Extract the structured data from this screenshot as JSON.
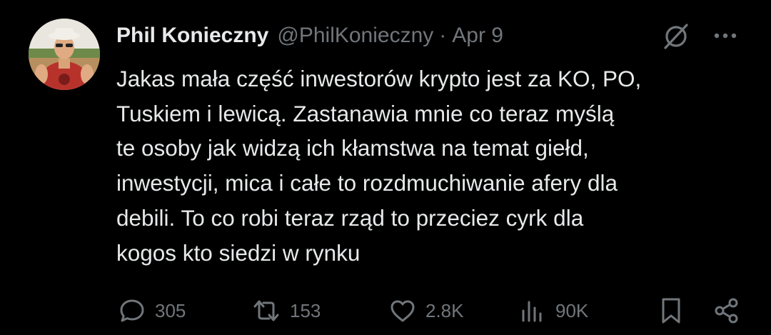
{
  "author": {
    "display_name": "Phil Konieczny",
    "handle": "@PhilKonieczny",
    "separator": "·",
    "date": "Apr 9"
  },
  "tweet": {
    "text": "Jakas mała część inwestorów krypto jest za KO, PO,\nTuskiem i  lewicą. Zastanawia mnie co teraz myślą\nte osoby jak widzą ich kłamstwa na temat giełd,\ninwestycji, mica i całe to rozdmuchiwanie afery dla\ndebili. To co robi teraz rząd to przeciez cyrk dla\nkogos kto siedzi w rynku"
  },
  "actions": {
    "replies": "305",
    "reposts": "153",
    "likes": "2.8K",
    "views": "90K"
  },
  "icons": {
    "grok": "grok-icon",
    "more": "more-icon",
    "reply": "reply-icon",
    "repost": "repost-icon",
    "like": "heart-icon",
    "views": "views-icon",
    "bookmark": "bookmark-icon",
    "share": "share-icon"
  },
  "colors": {
    "background": "#000000",
    "text_primary": "#e7e9ea",
    "text_secondary": "#71767b"
  }
}
